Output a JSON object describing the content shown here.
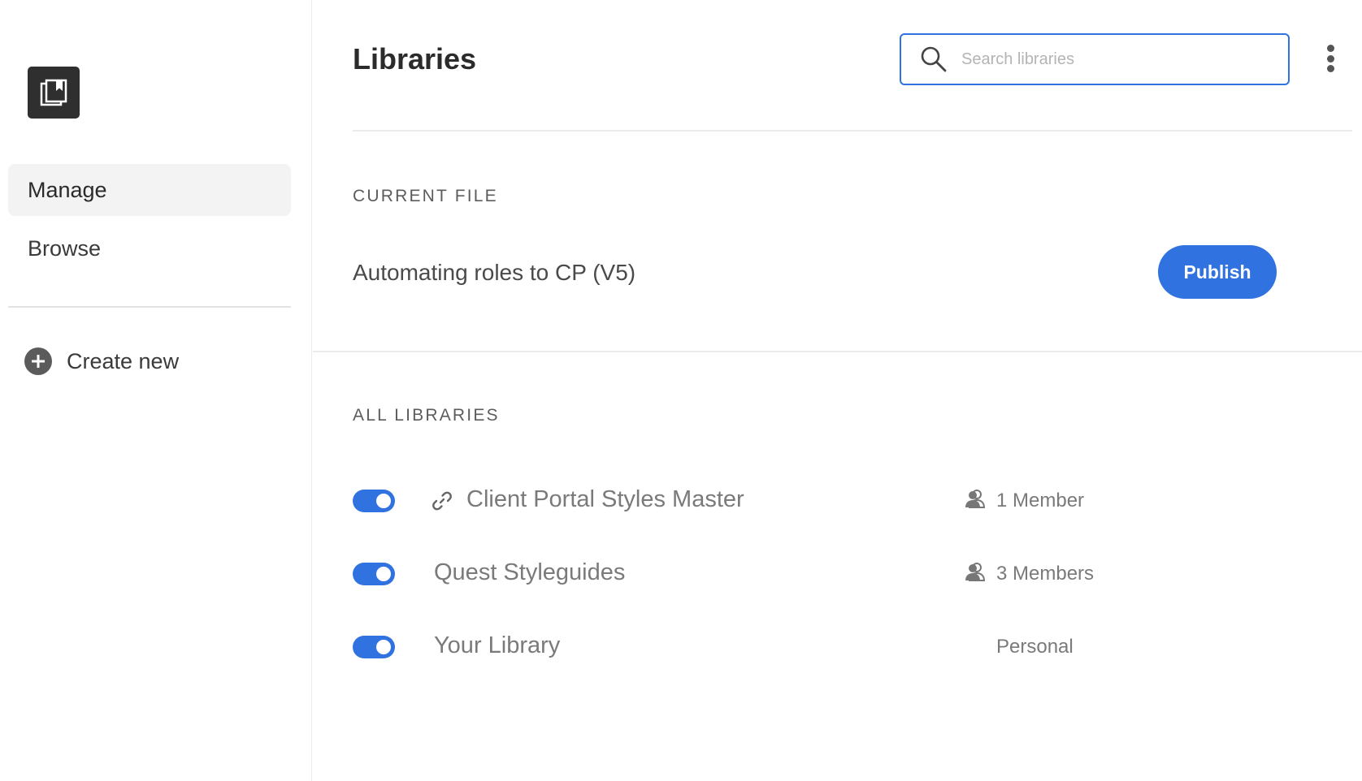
{
  "sidebar": {
    "logo_icon": "library-book-icon",
    "items": [
      {
        "label": "Manage",
        "active": true
      },
      {
        "label": "Browse",
        "active": false
      }
    ],
    "create_new_label": "Create new",
    "create_new_icon": "plus-circle-icon"
  },
  "header": {
    "title": "Libraries",
    "search": {
      "placeholder": "Search libraries",
      "value": "",
      "icon": "search-icon"
    },
    "menu_icon": "more-vertical-icon"
  },
  "current_file": {
    "section_label": "CURRENT FILE",
    "name": "Automating roles to CP (V5)",
    "publish_label": "Publish"
  },
  "all_libraries": {
    "section_label": "ALL LIBRARIES",
    "items": [
      {
        "name": "Client Portal Styles Master",
        "enabled": true,
        "link_icon": "link-icon",
        "member_icon": "member-icon",
        "meta": "1 Member"
      },
      {
        "name": "Quest Styleguides",
        "enabled": true,
        "member_icon": "member-icon",
        "meta": "3 Members"
      },
      {
        "name": "Your Library",
        "enabled": true,
        "meta": "Personal"
      }
    ]
  },
  "colors": {
    "accent": "#2f72e0",
    "logo_bg": "#2f2f2f",
    "active_nav_bg": "#f3f3f3"
  }
}
